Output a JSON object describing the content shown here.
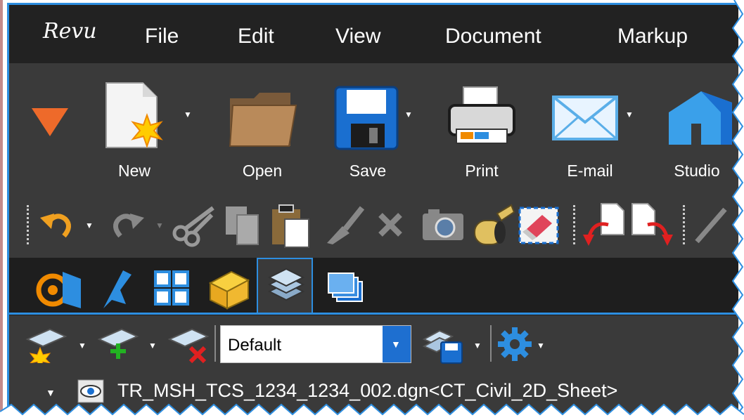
{
  "app": {
    "logo": "Revu"
  },
  "menu": {
    "items": [
      "File",
      "Edit",
      "View",
      "Document",
      "Markup"
    ]
  },
  "toolbar": {
    "new_label": "New",
    "open_label": "Open",
    "save_label": "Save",
    "print_label": "Print",
    "email_label": "E-mail",
    "studio_label": "Studio"
  },
  "layers": {
    "dropdown_value": "Default",
    "row_name": "TR_MSH_TCS_1234_1234_002.dgn<CT_Civil_2D_Sheet>"
  },
  "colors": {
    "accent": "#2d8ee0",
    "menubar_bg": "#222222",
    "toolbar_bg": "#3a3a3a",
    "tab_bg": "#1e1e1e"
  }
}
